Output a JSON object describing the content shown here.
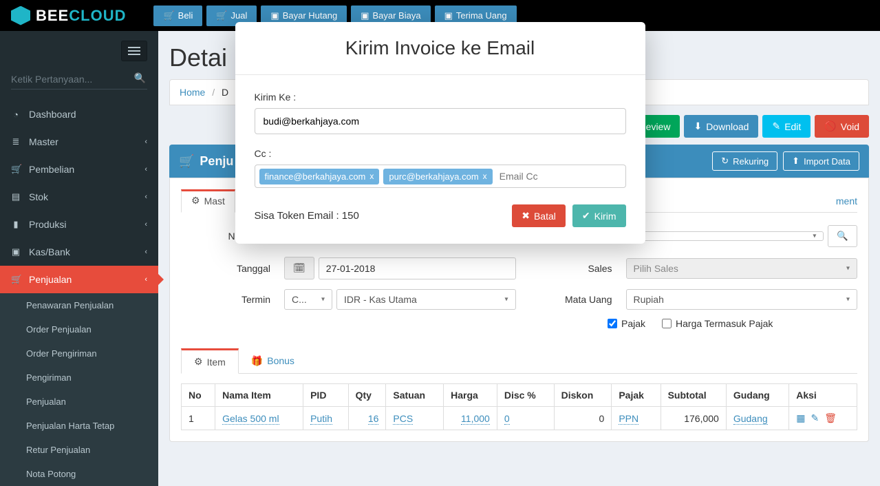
{
  "brand": {
    "name1": "BEE",
    "name2": "CLOUD"
  },
  "topActions": {
    "beli": "Beli",
    "jual": "Jual",
    "bayarHutang": "Bayar Hutang",
    "bayarBiaya": "Bayar Biaya",
    "terimaUang": "Terima Uang"
  },
  "search": {
    "placeholder": "Ketik Pertanyaan..."
  },
  "nav": {
    "dashboard": "Dashboard",
    "master": "Master",
    "pembelian": "Pembelian",
    "stok": "Stok",
    "produksi": "Produksi",
    "kasbank": "Kas/Bank",
    "penjualan": "Penjualan",
    "sub": {
      "penawaran": "Penawaran Penjualan",
      "order": "Order Penjualan",
      "pengirimanOrder": "Order Pengiriman",
      "pengiriman": "Pengiriman",
      "penjualan": "Penjualan",
      "harta": "Penjualan Harta Tetap",
      "retur": "Retur Penjualan",
      "nota": "Nota Potong"
    }
  },
  "page": {
    "title": "Detai"
  },
  "breadcrumb": {
    "home": "Home",
    "sep": "/",
    "current": "D"
  },
  "toolbar": {
    "preview": "eview",
    "download": "Download",
    "edit": "Edit",
    "void": "Void"
  },
  "subToolbar": {
    "rekuring": "Rekuring",
    "import": "Import Data"
  },
  "panel": {
    "title": "Penju"
  },
  "form": {
    "tabs": {
      "master": "Mast",
      "attachment": "ment"
    },
    "fields": {
      "noPenj": "No. Penju",
      "tanggal": "Tanggal",
      "tanggalVal": "27-01-2018",
      "termin": "Termin",
      "terminVal": "C...",
      "kas": "IDR - Kas Utama",
      "sales": "Sales",
      "salesPh": "Pilih Sales",
      "mataUang": "Mata Uang",
      "mataUangVal": "Rupiah",
      "pajak": "Pajak",
      "hargaTermasuk": "Harga Termasuk Pajak"
    }
  },
  "itemTabs": {
    "item": "Item",
    "bonus": "Bonus"
  },
  "table": {
    "head": {
      "no": "No",
      "nama": "Nama Item",
      "pid": "PID",
      "qty": "Qty",
      "satuan": "Satuan",
      "harga": "Harga",
      "discp": "Disc %",
      "diskon": "Diskon",
      "pajak": "Pajak",
      "subtotal": "Subtotal",
      "gudang": "Gudang",
      "aksi": "Aksi"
    },
    "rows": [
      {
        "no": "1",
        "nama": "Gelas 500 ml",
        "pid": "Putih",
        "qty": "16",
        "satuan": "PCS",
        "harga": "11,000",
        "discp": "0",
        "diskon": "0",
        "pajak": "PPN",
        "subtotal": "176,000",
        "gudang": "Gudang"
      }
    ]
  },
  "modal": {
    "title": "Kirim Invoice ke Email",
    "kirimKeLabel": "Kirim Ke :",
    "kirimKeVal": "budi@berkahjaya.com",
    "ccLabel": "Cc :",
    "ccTags": [
      "finance@berkahjaya.com",
      "purc@berkahjaya.com"
    ],
    "ccPlaceholder": "Email Cc",
    "tokenText": "Sisa Token Email : 150",
    "batal": "Batal",
    "kirim": "Kirim"
  }
}
